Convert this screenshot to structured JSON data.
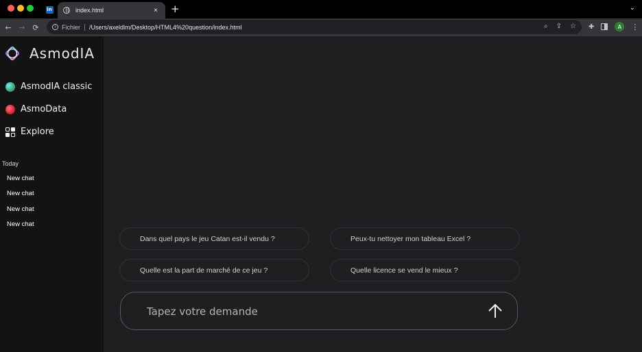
{
  "browser": {
    "pinned_tab_badge": "in",
    "tab_title": "index.html",
    "tab_close": "×",
    "new_tab": "+",
    "tab_menu": "⌄",
    "back": "←",
    "forward": "→",
    "reload": "⟳",
    "scheme_label": "Fichier",
    "url": "/Users/axeldlm/Desktop/HTML4%20question/index.html",
    "profile_initial": "A",
    "menu": "⋮"
  },
  "sidebar": {
    "brand_name": "AsmodIA",
    "nav": [
      {
        "label": "AsmodIA classic",
        "icon": "asmodia-orb-icon"
      },
      {
        "label": "AsmoData",
        "icon": "asmodata-orb-icon"
      },
      {
        "label": "Explore",
        "icon": "grid-icon"
      }
    ],
    "section_label": "Today",
    "chats": [
      "New chat",
      "New chat",
      "New chat",
      "New chat"
    ]
  },
  "suggestions": [
    "Dans quel pays le jeu Catan est-il vendu ?",
    "Peux-tu nettoyer mon tableau Excel ?",
    "Quelle est la part de marché de ce jeu ?",
    "Quelle licence se vend le mieux ?"
  ],
  "composer": {
    "placeholder": "Tapez votre demande",
    "value": ""
  },
  "colors": {
    "sidebar_bg": "#131314",
    "main_bg": "#1f1f22",
    "suggestion_border": "#323236",
    "composer_border": "#57575c"
  }
}
